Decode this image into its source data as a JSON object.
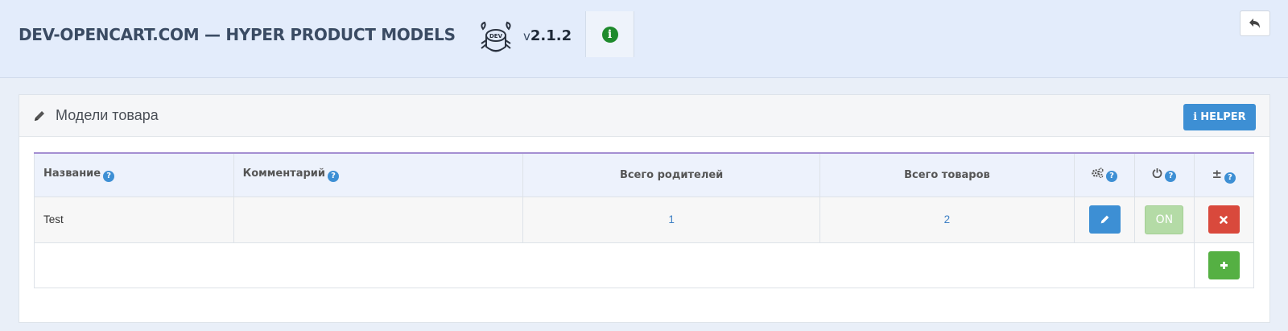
{
  "header": {
    "title": "DEV-OPENCART.COM — HYPER PRODUCT MODELS",
    "logo_text": "DEV",
    "version_prefix": "v",
    "version": "2.1.2",
    "info_icon": "info-circle-icon",
    "back_icon": "reply-icon"
  },
  "panel": {
    "title": "Модели товара",
    "title_icon": "pencil-icon",
    "helper_label": "HELPER",
    "helper_icon": "info-icon"
  },
  "table": {
    "columns": [
      {
        "label": "Название",
        "help": true
      },
      {
        "label": "Комментарий",
        "help": true
      },
      {
        "label": "Всего родителей",
        "help": false
      },
      {
        "label": "Всего товаров",
        "help": false
      },
      {
        "icon": "cogs-icon",
        "help": true
      },
      {
        "icon": "power-icon",
        "help": true
      },
      {
        "label": "±",
        "help": true
      }
    ],
    "help_glyph": "?",
    "rows": [
      {
        "name": "Test",
        "comment": "",
        "parents": "1",
        "products": "2",
        "status": "ON"
      }
    ]
  },
  "colors": {
    "primary": "#3d8fd4",
    "danger": "#d9493c",
    "success": "#55b043",
    "on": "#b4dba6",
    "header_bg": "#e3ecfb",
    "table_accent": "#a48fd2"
  }
}
